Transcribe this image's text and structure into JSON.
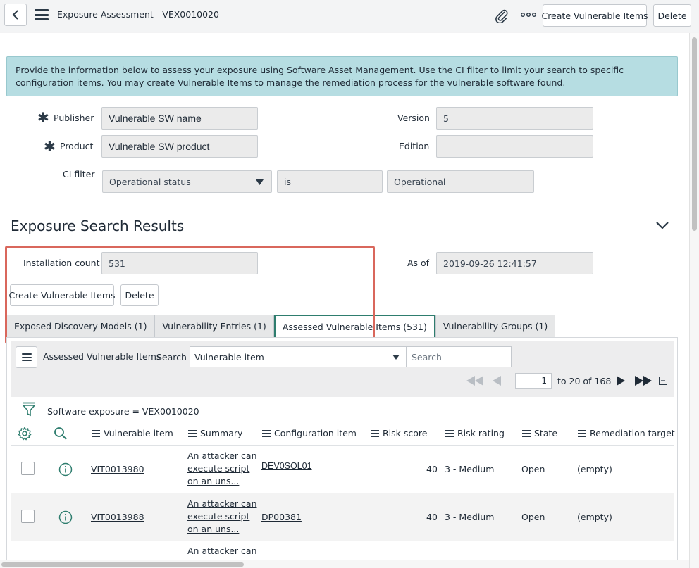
{
  "header": {
    "title": "Exposure Assessment - VEX0010020",
    "create_button": "Create Vulnerable Items",
    "delete_button": "Delete"
  },
  "info_message": "Provide the information below to assess your exposure using Software Asset Management. Use the CI filter to limit your search to specific configuration items. You may create Vulnerable Items to manage the remediation process for the vulnerable software found.",
  "form": {
    "publisher_label": "Publisher",
    "publisher_value": "Vulnerable SW name",
    "product_label": "Product",
    "product_value": "Vulnerable SW product",
    "version_label": "Version",
    "version_value": "5",
    "edition_label": "Edition",
    "edition_value": "",
    "ci_filter_label": "CI filter",
    "ci_filter_field": "Operational status",
    "ci_filter_operator": "is",
    "ci_filter_value": "Operational"
  },
  "results": {
    "section_title": "Exposure Search Results",
    "installation_count_label": "Installation count",
    "installation_count_value": "531",
    "as_of_label": "As of",
    "as_of_value": "2019-09-26 12:41:57",
    "create_button": "Create Vulnerable Items",
    "delete_button": "Delete"
  },
  "tabs": [
    {
      "label": "Exposed Discovery Models (1)"
    },
    {
      "label": "Vulnerability Entries (1)"
    },
    {
      "label": "Assessed Vulnerable Items (531)"
    },
    {
      "label": "Vulnerability Groups (1)"
    }
  ],
  "list": {
    "title": "Assessed Vulnerable Items",
    "search_label": "Search",
    "search_field": "Vulnerable item",
    "search_placeholder": "Search",
    "page_input": "1",
    "page_range": "to 20 of 168",
    "filter_text": "Software exposure = VEX0010020",
    "columns": [
      "Vulnerable item",
      "Summary",
      "Configuration item",
      "Risk score",
      "Risk rating",
      "State",
      "Remediation target"
    ],
    "rows": [
      {
        "item": "VIT0013980",
        "summary": "An attacker can execute script on an uns...",
        "ci": "DEV0SOL01",
        "risk_score": "40",
        "risk_rating": "3 - Medium",
        "state": "Open",
        "target": "(empty)"
      },
      {
        "item": "VIT0013988",
        "summary": "An attacker can execute script on an uns...",
        "ci": "DP00381",
        "risk_score": "40",
        "risk_rating": "3 - Medium",
        "state": "Open",
        "target": "(empty)"
      },
      {
        "item": "",
        "summary": "An attacker can",
        "ci": "",
        "risk_score": "",
        "risk_rating": "",
        "state": "",
        "target": ""
      }
    ]
  }
}
